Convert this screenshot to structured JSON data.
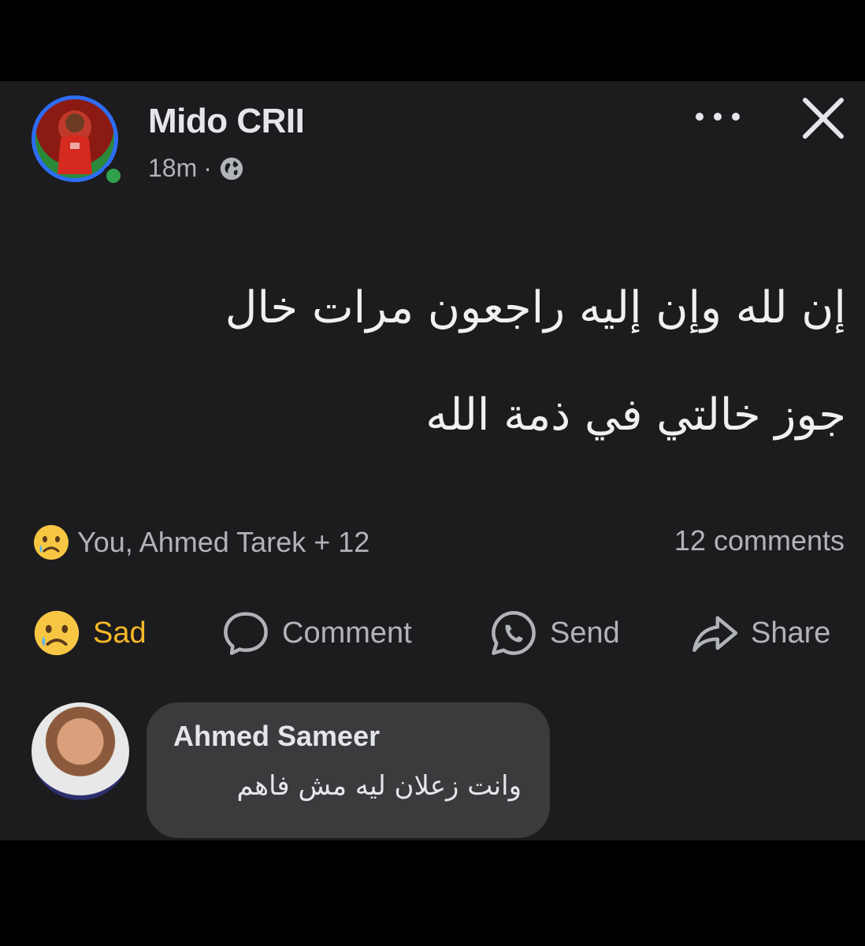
{
  "post": {
    "author": "Mido CRII",
    "time": "18m",
    "separator": "·",
    "privacy_icon": "globe-icon",
    "text_line1": "إن لله وإن إليه راجعون مرات خال",
    "text_line2": "جوز خالتي في ذمة الله"
  },
  "reactions": {
    "summary": "You, Ahmed Tarek + 12",
    "comments_count": "12 comments",
    "reaction_icon": "sad-emoji-icon"
  },
  "actions": {
    "sad_label": "Sad",
    "comment_label": "Comment",
    "send_label": "Send",
    "share_label": "Share"
  },
  "comment": {
    "author": "Ahmed Sameer",
    "text": "وانت زعلان ليه مش فاهم"
  },
  "colors": {
    "page_bg": "#000000",
    "card_bg": "#1c1c1e",
    "bubble_bg": "#3a3b3c",
    "sad_accent": "#f7b928",
    "online": "#31a24c",
    "story_ring": "#2d6df6"
  }
}
